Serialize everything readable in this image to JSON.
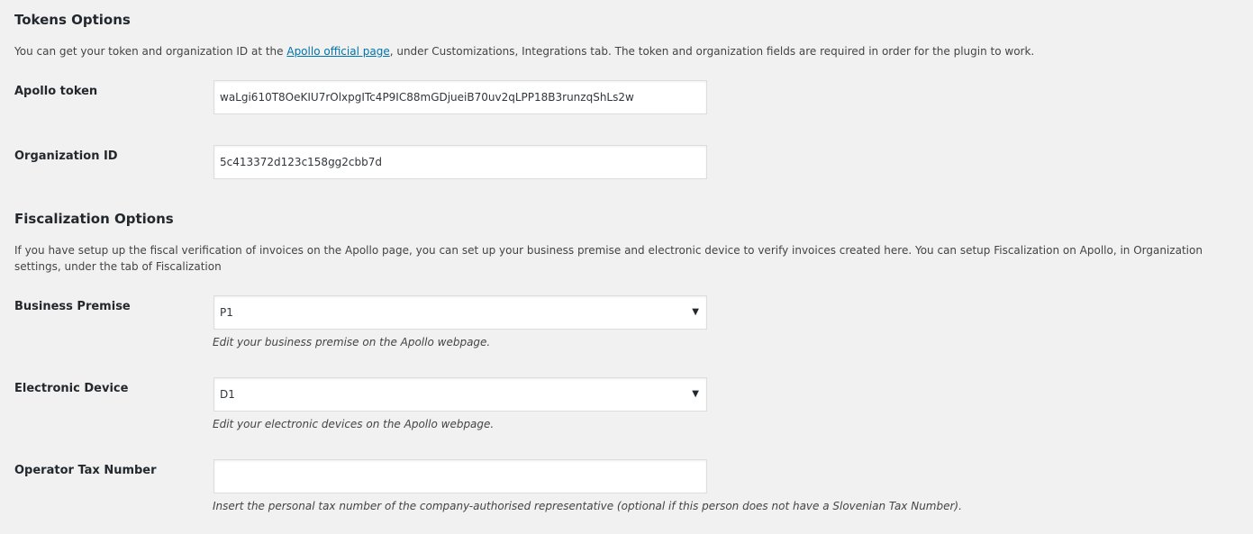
{
  "tokens": {
    "title": "Tokens Options",
    "desc_before": "You can get your token and organization ID at the ",
    "link_text": "Apollo official page",
    "desc_after": ", under Customizations, Integrations tab. The token and organization fields are required in order for the plugin to work.",
    "token_label": "Apollo token",
    "token_value": "waLgi610T8OeKIU7rOlxpgITc4P9IC88mGDjueiB70uv2qLPP18B3runzqShLs2w",
    "org_label": "Organization ID",
    "org_value": "5c413372d123c158gg2cbb7d"
  },
  "fiscal": {
    "title": "Fiscalization Options",
    "desc": "If you have setup up the fiscal verification of invoices on the Apollo page, you can set up your business premise and electronic device to verify invoices created here. You can setup Fiscalization on Apollo, in Organization settings, under the tab of Fiscalization",
    "premise_label": "Business Premise",
    "premise_value": "P1",
    "premise_hint": "Edit your business premise on the Apollo webpage.",
    "device_label": "Electronic Device",
    "device_value": "D1",
    "device_hint": "Edit your electronic devices on the Apollo webpage.",
    "tax_label": "Operator Tax Number",
    "tax_value": "",
    "tax_hint": "Insert the personal tax number of the company-authorised representative (optional if this person does not have a Slovenian Tax Number)."
  },
  "icons": {
    "dropdown": "triangle-down-icon"
  }
}
